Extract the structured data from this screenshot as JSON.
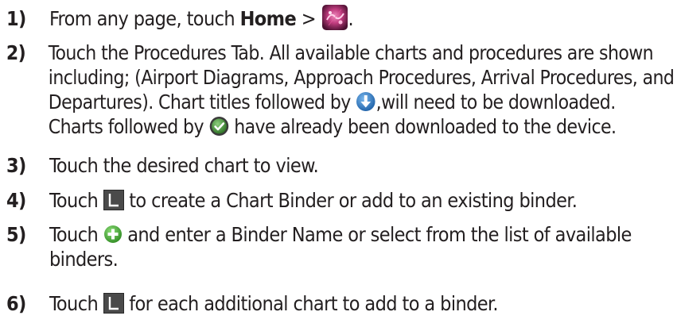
{
  "steps": [
    {
      "number": "1)",
      "text_before": "From any page, touch ",
      "bold": "Home",
      "text_after": " > ",
      "icon": "charts-app-icon",
      "end": "."
    },
    {
      "number": "2)",
      "line1": "Touch the Procedures Tab.  All available charts and procedures are shown",
      "line2": "including; (Airport Diagrams, Approach Procedures, Arrival Procedures, and",
      "line3_before": "Departures).  Chart titles followed by ",
      "line3_icon": "download-icon",
      "line3_after": ",will need to be downloaded.",
      "line4_before": "Charts followed by ",
      "line4_icon": "downloaded-check-icon",
      "line4_after": " have already been downloaded to the device."
    },
    {
      "number": "3)",
      "text": "Touch the desired chart to view."
    },
    {
      "number": "4)",
      "text_before": "Touch ",
      "icon": "binder-icon",
      "text_after": " to create a Chart Binder or add to an existing binder."
    },
    {
      "number": "5)",
      "line1_before": "Touch ",
      "line1_icon": "add-plus-icon",
      "line1_after": " and enter a Binder Name or select from the list of available",
      "line2": "binders."
    },
    {
      "number": "6)",
      "text_before": "Touch ",
      "icon": "binder-icon",
      "text_after": " for each additional chart to add to a binder."
    }
  ],
  "colors": {
    "text": "#231f20",
    "download_blue": "#2f7fc8",
    "check_green": "#3d8a33",
    "binder_gray": "#4a4a4a",
    "plus_green": "#4cae3b",
    "app_magenta": "#b0306e"
  }
}
